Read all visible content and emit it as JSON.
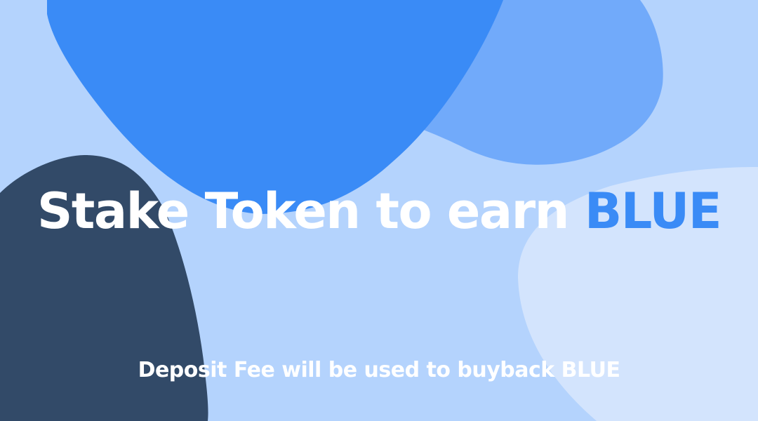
{
  "hero": {
    "title_prefix": "Stake Token to earn",
    "title_highlight": "BLUE",
    "subtitle": "Deposit Fee will be used to buyback BLUE"
  },
  "colors": {
    "background": "#b4d3fd",
    "blob_dark_blue": "#3a8bf6",
    "blob_mid_blue": "#71aafa",
    "blob_light": "#d3e4fd",
    "blob_navy": "#324a68",
    "text_white": "#ffffff",
    "text_accent": "#3a8bf6"
  }
}
